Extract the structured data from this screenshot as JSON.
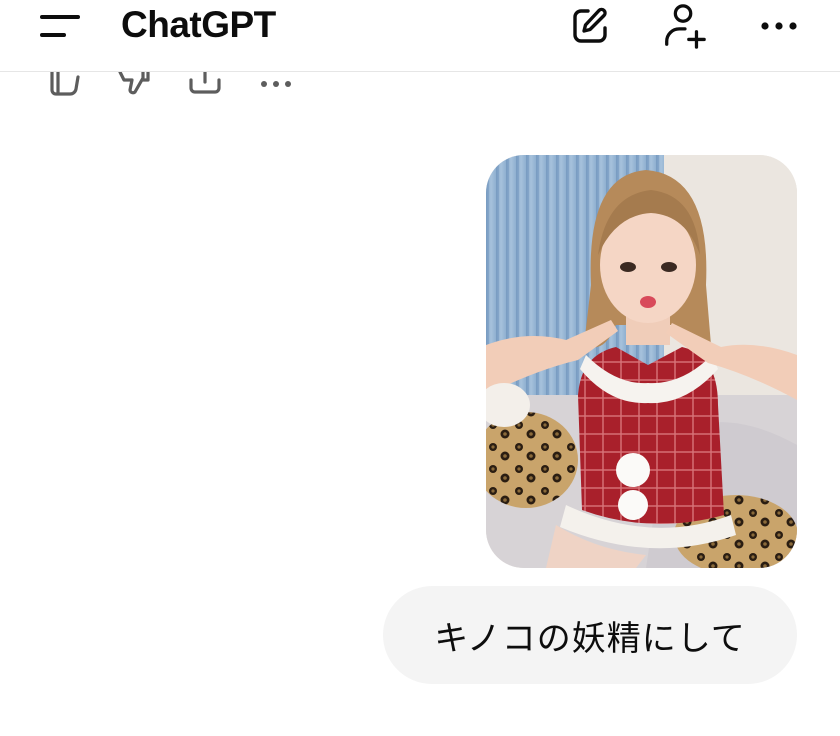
{
  "header": {
    "title": "ChatGPT",
    "menu_icon": "sidebar-menu-icon",
    "new_chat_icon": "edit-icon",
    "add_user_icon": "add-user-icon",
    "more_icon": "more-horizontal-icon"
  },
  "previous_response_actions": [
    {
      "name": "like",
      "icon": "thumbs-up-icon"
    },
    {
      "name": "dislike",
      "icon": "thumbs-down-icon"
    },
    {
      "name": "share",
      "icon": "share-icon"
    },
    {
      "name": "more",
      "icon": "more-horizontal-icon"
    }
  ],
  "conversation": {
    "user_image": {
      "description_icon": "uploaded-photo"
    },
    "user_message": "キノコの妖精にして"
  },
  "colors": {
    "background": "#ffffff",
    "bubble": "#f4f4f4",
    "text": "#0d0d0d",
    "divider": "#e6e6e6"
  }
}
